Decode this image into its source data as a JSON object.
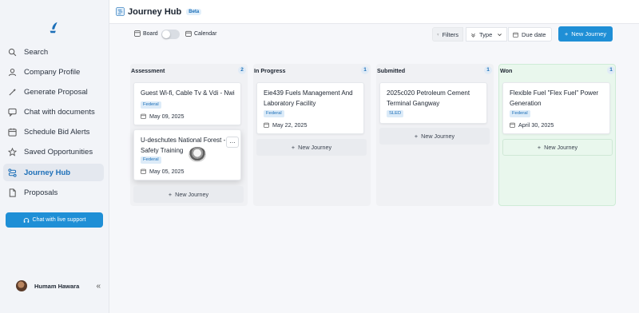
{
  "sidebar": {
    "items": [
      {
        "label": "Search",
        "icon": "search-icon"
      },
      {
        "label": "Company Profile",
        "icon": "user-icon"
      },
      {
        "label": "Generate Proposal",
        "icon": "magic-wand-icon"
      },
      {
        "label": "Chat with documents",
        "icon": "chat-icon"
      },
      {
        "label": "Schedule Bid Alerts",
        "icon": "calendar-icon"
      },
      {
        "label": "Saved Opportunities",
        "icon": "star-icon"
      },
      {
        "label": "Journey Hub",
        "icon": "route-icon",
        "active": true
      },
      {
        "label": "Proposals",
        "icon": "document-icon"
      }
    ],
    "support_button": "Chat with live support",
    "user_name": "Humam Hawara"
  },
  "header": {
    "title": "Journey Hub",
    "badge": "Beta"
  },
  "toolbar": {
    "board_label": "Board",
    "calendar_label": "Calendar",
    "filters_label": "Filters",
    "type_label": "Type",
    "due_label": "Due date",
    "new_journey_label": "New Journey"
  },
  "columns": [
    {
      "title": "Assessment",
      "count": "2",
      "cards": [
        {
          "title": "Guest Wi-fi, Cable Tv & Vdi - Nwi",
          "tag": "Federal",
          "date": "May 09, 2025"
        },
        {
          "title": "U-deschutes National Forest - Safety Training",
          "tag": "Federal",
          "date": "May 05, 2025"
        }
      ],
      "new_label": "New Journey"
    },
    {
      "title": "In Progress",
      "count": "1",
      "cards": [
        {
          "title": "Eie439 Fuels Management And Laboratory Facility",
          "tag": "Federal",
          "date": "May 22, 2025"
        }
      ],
      "new_label": "New Journey"
    },
    {
      "title": "Submitted",
      "count": "1",
      "cards": [
        {
          "title": "2025c020 Petroleum Cement Terminal Gangway",
          "tag": "SLED",
          "date": ""
        }
      ],
      "new_label": "New Journey"
    },
    {
      "title": "Won",
      "count": "1",
      "cards": [
        {
          "title": "Flexible Fuel \"Flex Fuel\" Power Generation",
          "tag": "Federal",
          "date": "April 30, 2025"
        }
      ],
      "new_label": "New Journey"
    }
  ],
  "colors": {
    "accent": "#1f8fd6",
    "won_bg": "#e9f7ed",
    "tag_bg": "#dcebf8"
  }
}
